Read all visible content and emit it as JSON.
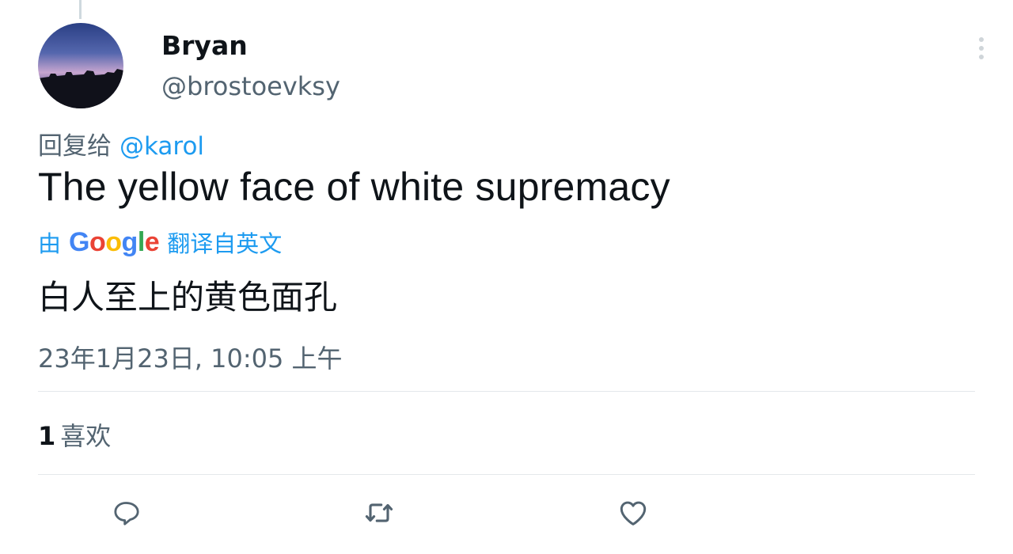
{
  "user": {
    "display_name": "Bryan",
    "handle": "@brostoevksy"
  },
  "reply": {
    "prefix": "回复给",
    "mention": "@karol"
  },
  "tweet": {
    "text": "The yellow face of white supremacy"
  },
  "translation": {
    "by_label": "由",
    "provider_logo_letters": [
      "G",
      "o",
      "o",
      "g",
      "l",
      "e"
    ],
    "suffix_label": "翻译自英文",
    "text": "白人至上的黄色面孔"
  },
  "timestamp": "23年1月23日, 10:05 上午",
  "stats": {
    "likes_count": "1",
    "likes_label": "喜欢"
  },
  "actions": [
    {
      "name": "reply",
      "icon": "reply-icon"
    },
    {
      "name": "retweet",
      "icon": "retweet-icon"
    },
    {
      "name": "like",
      "icon": "heart-icon"
    }
  ],
  "colors": {
    "text_primary": "#0f1419",
    "text_secondary": "#536471",
    "link_blue": "#1d9bf0",
    "divider": "#e4e8eb",
    "google_blue": "#4285f4",
    "google_red": "#ea4335",
    "google_yellow": "#fbbc05",
    "google_green": "#34a853"
  }
}
